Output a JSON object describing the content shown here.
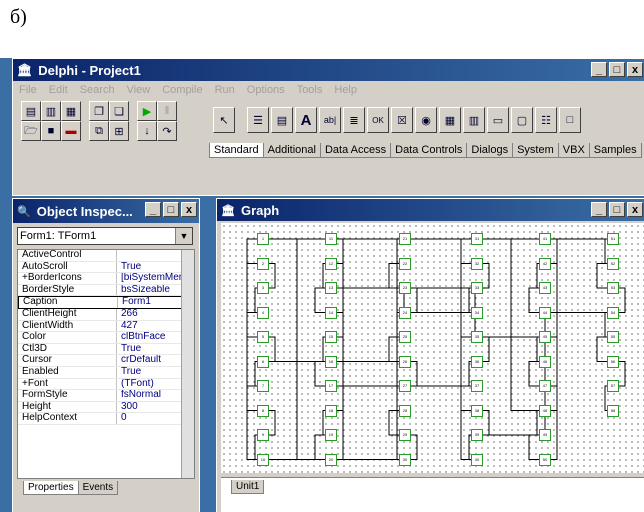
{
  "caption": "б)",
  "main_window": {
    "title": "Delphi - Project1",
    "menu": [
      "File",
      "Edit",
      "Search",
      "View",
      "Compile",
      "Run",
      "Options",
      "Tools",
      "Help"
    ],
    "palette_tabs": [
      "Standard",
      "Additional",
      "Data Access",
      "Data Controls",
      "Dialogs",
      "System",
      "VBX",
      "Samples"
    ],
    "selected_tab": "Standard",
    "window_buttons": [
      "_",
      "□",
      "x"
    ]
  },
  "object_inspector": {
    "title": "Object Inspec...",
    "selector": "Form1: TForm1",
    "properties": [
      {
        "name": "ActiveControl",
        "value": ""
      },
      {
        "name": "AutoScroll",
        "value": "True"
      },
      {
        "name": "+BorderIcons",
        "value": "[biSystemMenu"
      },
      {
        "name": "BorderStyle",
        "value": "bsSizeable"
      },
      {
        "name": "Caption",
        "value": "Form1"
      },
      {
        "name": "ClientHeight",
        "value": "266"
      },
      {
        "name": "ClientWidth",
        "value": "427"
      },
      {
        "name": "Color",
        "value": "clBtnFace"
      },
      {
        "name": "Ctl3D",
        "value": "True"
      },
      {
        "name": "Cursor",
        "value": "crDefault"
      },
      {
        "name": "Enabled",
        "value": "True"
      },
      {
        "name": "+Font",
        "value": "(TFont)"
      },
      {
        "name": "FormStyle",
        "value": "fsNormal"
      },
      {
        "name": "Height",
        "value": "300"
      },
      {
        "name": "HelpContext",
        "value": "0"
      }
    ],
    "tabs": [
      "Properties",
      "Events"
    ]
  },
  "graph_window": {
    "title": "Graph",
    "unit_tab": "Unit1",
    "columns": [
      {
        "nodes": [
          "1",
          "2",
          "3",
          "4",
          "5",
          "6",
          "7",
          "8",
          "9",
          "10"
        ]
      },
      {
        "nodes": [
          "11",
          "12",
          "13",
          "14",
          "15",
          "16",
          "17",
          "18",
          "19",
          "20"
        ]
      },
      {
        "nodes": [
          "21",
          "22",
          "23",
          "24",
          "25",
          "26",
          "27",
          "28",
          "29",
          "30"
        ]
      },
      {
        "nodes": [
          "31",
          "32",
          "33",
          "34",
          "35",
          "36",
          "37",
          "38",
          "39",
          "40"
        ]
      },
      {
        "nodes": [
          "41",
          "42",
          "43",
          "44",
          "45",
          "46",
          "47",
          "48",
          "49",
          "50"
        ]
      },
      {
        "nodes": [
          "51",
          "52",
          "53",
          "54",
          "55",
          "56",
          "57",
          "58"
        ]
      }
    ]
  }
}
